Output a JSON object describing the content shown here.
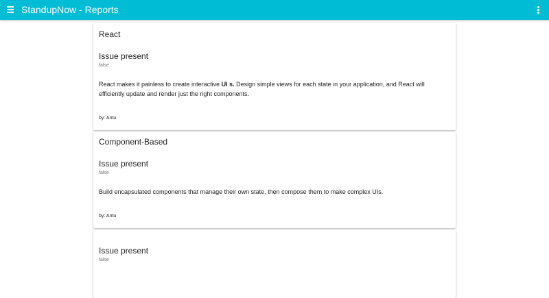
{
  "appbar": {
    "title": "StandupNow - Reports",
    "menu_icon": "hamburger-menu-icon",
    "more_icon": "more-vert-icon",
    "color": "#00bcd4"
  },
  "reports": [
    {
      "title": "React",
      "issue_label": "Issue present",
      "issue_value": "false",
      "text_before": "React makes it painless to create interactive ",
      "text_bold": "UI s.",
      "text_after": " Design simple views for each state in your application, and React will efficiently update and render just the right components.",
      "author": "by: Antu"
    },
    {
      "title": "Component-Based",
      "issue_label": "Issue present",
      "issue_value": "false",
      "text": "Build encapsulated components that manage their own state, then compose them to make complex UIs.",
      "author": "by: Antu"
    },
    {
      "title": "",
      "issue_label": "Issue present",
      "issue_value": "false"
    }
  ]
}
